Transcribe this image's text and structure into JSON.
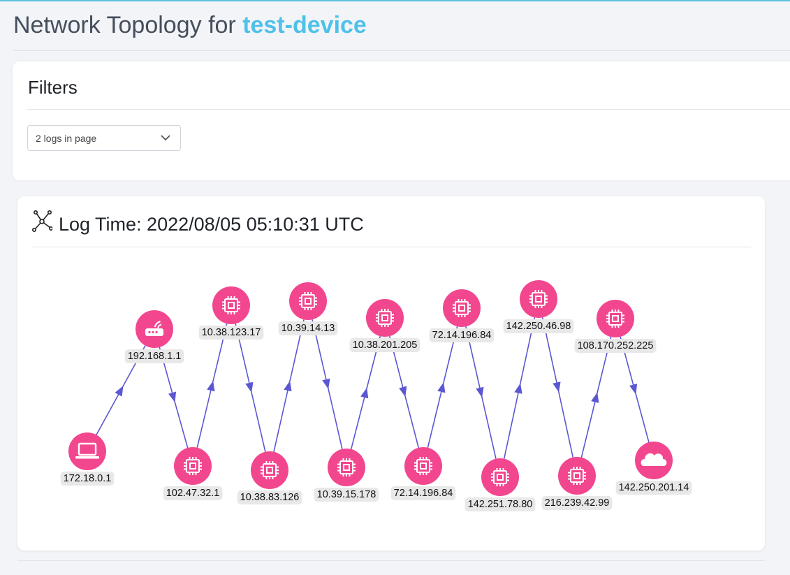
{
  "header": {
    "title_prefix": "Network Topology for",
    "device": "test-device"
  },
  "filters": {
    "title": "Filters",
    "select_value": "2 logs in page"
  },
  "topology": {
    "log_time": "Log Time: 2022/08/05 05:10:31 UTC",
    "colors": {
      "node": "#f2478f",
      "edge": "#5b57d1",
      "label_bg": "#e8e8e8"
    },
    "nodes": [
      {
        "id": "n1",
        "label": "172.18.0.1",
        "icon": "laptop-icon"
      },
      {
        "id": "n2",
        "label": "192.168.1.1",
        "icon": "router-icon"
      },
      {
        "id": "n3",
        "label": "102.47.32.1",
        "icon": "chip-icon"
      },
      {
        "id": "n4",
        "label": "10.38.123.17",
        "icon": "chip-icon"
      },
      {
        "id": "n5",
        "label": "10.38.83.126",
        "icon": "chip-icon"
      },
      {
        "id": "n6",
        "label": "10.39.14.13",
        "icon": "chip-icon"
      },
      {
        "id": "n7",
        "label": "10.39.15.178",
        "icon": "chip-icon"
      },
      {
        "id": "n8",
        "label": "10.38.201.205",
        "icon": "chip-icon"
      },
      {
        "id": "n9",
        "label": "72.14.196.84",
        "icon": "chip-icon"
      },
      {
        "id": "n10",
        "label": "72.14.196.84",
        "icon": "chip-icon"
      },
      {
        "id": "n11",
        "label": "142.251.78.80",
        "icon": "chip-icon"
      },
      {
        "id": "n12",
        "label": "142.250.46.98",
        "icon": "chip-icon"
      },
      {
        "id": "n13",
        "label": "216.239.42.99",
        "icon": "chip-icon"
      },
      {
        "id": "n14",
        "label": "108.170.252.225",
        "icon": "chip-icon"
      },
      {
        "id": "n15",
        "label": "142.250.201.14",
        "icon": "cloud-icon"
      }
    ],
    "edges": [
      [
        "n1",
        "n2"
      ],
      [
        "n2",
        "n3"
      ],
      [
        "n3",
        "n4"
      ],
      [
        "n4",
        "n5"
      ],
      [
        "n5",
        "n6"
      ],
      [
        "n6",
        "n7"
      ],
      [
        "n7",
        "n8"
      ],
      [
        "n8",
        "n9"
      ],
      [
        "n9",
        "n10"
      ],
      [
        "n10",
        "n11"
      ],
      [
        "n11",
        "n12"
      ],
      [
        "n12",
        "n13"
      ],
      [
        "n13",
        "n14"
      ],
      [
        "n14",
        "n15"
      ]
    ]
  }
}
